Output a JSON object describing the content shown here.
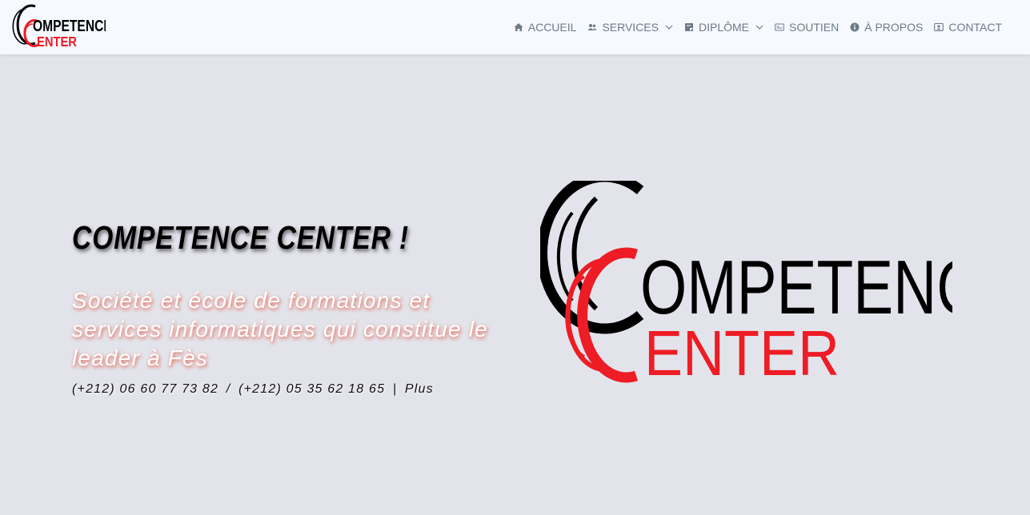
{
  "brand": {
    "logo_word_top": "OMPETENCE",
    "logo_word_bottom": "ENTER",
    "colors": {
      "black": "#000000",
      "red": "#ee1c25"
    }
  },
  "nav": {
    "items": [
      {
        "label": "ACCUEIL",
        "icon": "home-icon"
      },
      {
        "label": "SERVICES",
        "icon": "users-icon",
        "dropdown": true
      },
      {
        "label": "DIPLÔME",
        "icon": "certificate-icon",
        "dropdown": true
      },
      {
        "label": "SOUTIEN",
        "icon": "id-card-icon"
      },
      {
        "label": "À PROPOS",
        "icon": "info-icon"
      },
      {
        "label": "CONTACT",
        "icon": "contact-card-icon"
      }
    ],
    "text_color": "#6d7b86"
  },
  "hero": {
    "title": "COMPETENCE CENTER !",
    "tagline": "Société et école de formations et services informatiques qui constitue le leader à Fès",
    "phone1": "(+212) 06 60 77 73 82",
    "separator1": "/",
    "phone2": "(+212) 05 35 62 18 65",
    "separator2": "|",
    "more_link": "Plus",
    "background": "#e3e4eb"
  }
}
